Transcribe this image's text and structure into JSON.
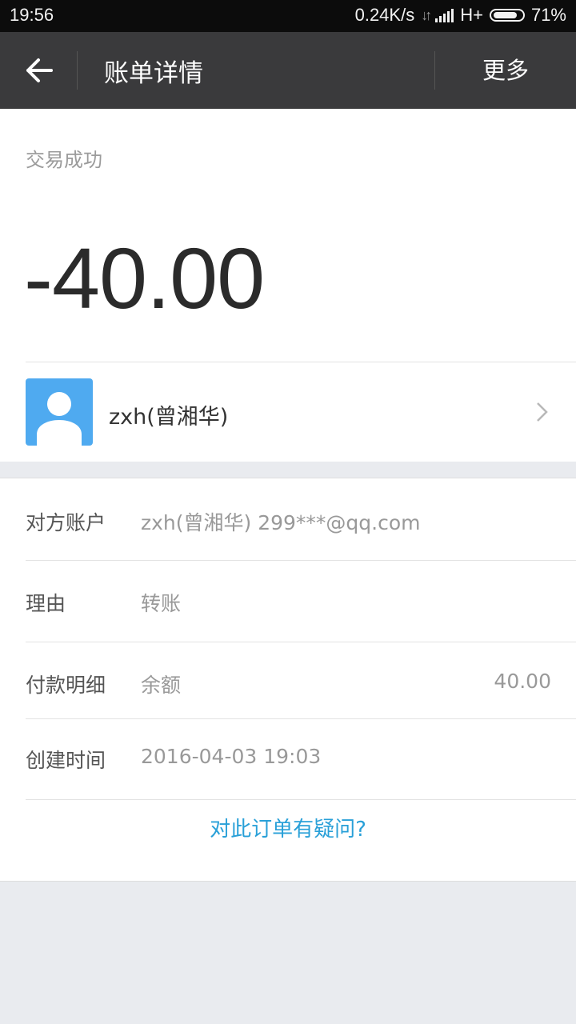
{
  "status_bar": {
    "time": "19:56",
    "speed": "0.24K/s",
    "network": "H+",
    "battery": "71%"
  },
  "title_bar": {
    "back_icon": "arrow-left-icon",
    "title": "账单详情",
    "more_label": "更多"
  },
  "summary": {
    "status": "交易成功",
    "amount": "-40.00"
  },
  "payee": {
    "avatar_icon": "user-avatar-icon",
    "name": "zxh(曾湘华)",
    "chevron_icon": "chevron-right-icon"
  },
  "details": [
    {
      "label": "对方账户",
      "value": "zxh(曾湘华) 299***@qq.com",
      "amount": ""
    },
    {
      "label": "理由",
      "value": "转账",
      "amount": ""
    },
    {
      "label": "付款明细",
      "value": "余额",
      "amount": "40.00"
    },
    {
      "label": "创建时间",
      "value": "2016-04-03 19:03",
      "amount": ""
    }
  ],
  "question_link": "对此订单有疑问?",
  "colors": {
    "title_bar_bg": "#3a3a3c",
    "avatar_bg": "#4faaf0",
    "link": "#29a0d8",
    "page_bg": "#e9ebef"
  }
}
